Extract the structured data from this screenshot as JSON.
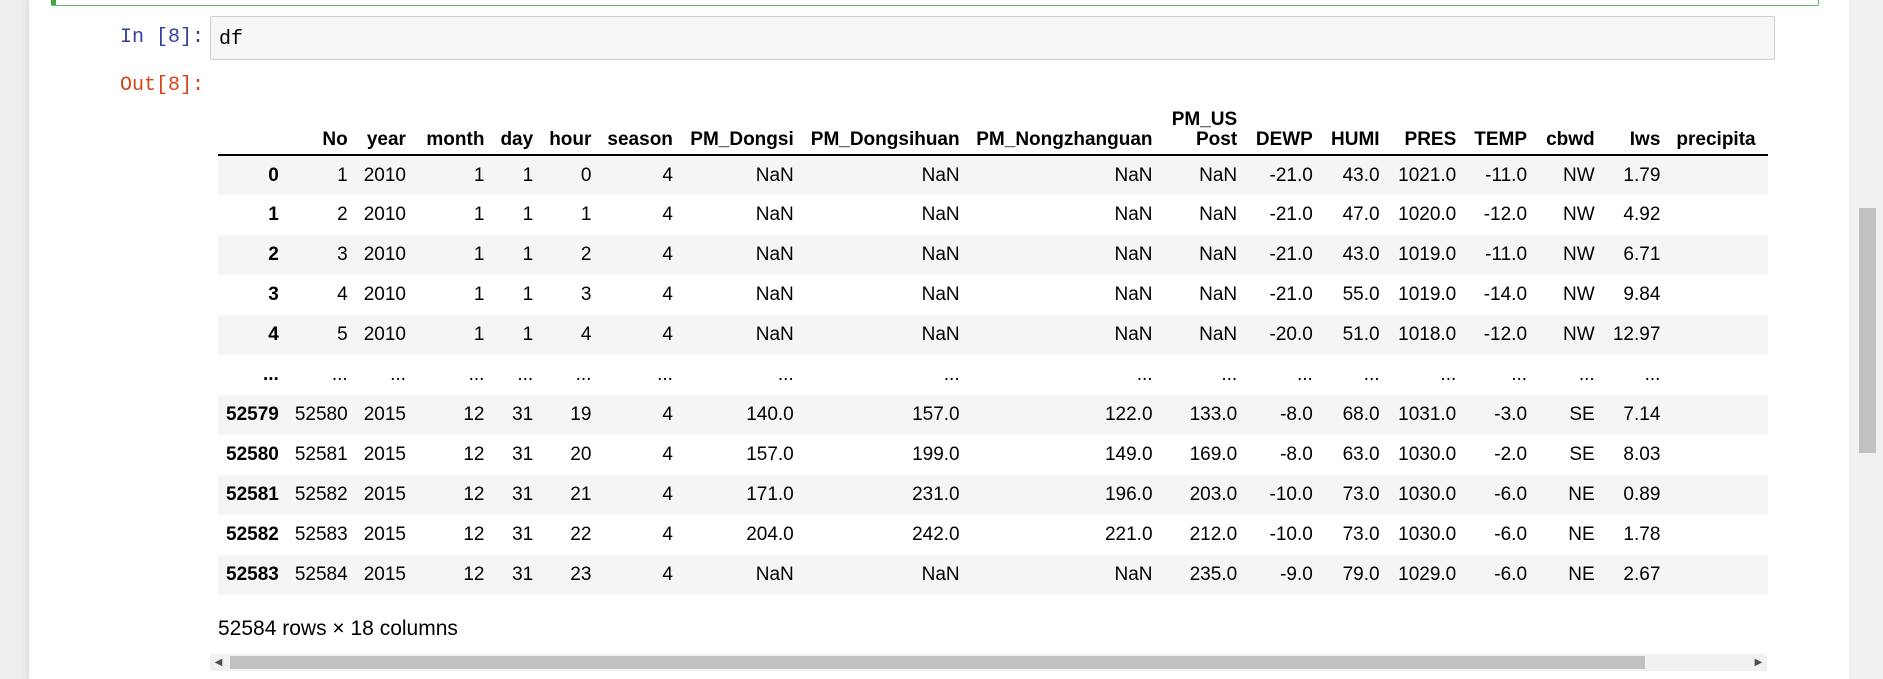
{
  "input_cell": {
    "prompt": "In  [8]:",
    "code": "df"
  },
  "output_cell": {
    "prompt": "Out[8]:",
    "columns": [
      "",
      "No",
      "year",
      "month",
      "day",
      "hour",
      "season",
      "PM_Dongsi",
      "PM_Dongsihuan",
      "PM_Nongzhanguan",
      "PM_US Post",
      "DEWP",
      "HUMI",
      "PRES",
      "TEMP",
      "cbwd",
      "Iws",
      "precipita"
    ],
    "rows": [
      [
        "0",
        "1",
        "2010",
        "1",
        "1",
        "0",
        "4",
        "NaN",
        "NaN",
        "NaN",
        "NaN",
        "-21.0",
        "43.0",
        "1021.0",
        "-11.0",
        "NW",
        "1.79",
        ""
      ],
      [
        "1",
        "2",
        "2010",
        "1",
        "1",
        "1",
        "4",
        "NaN",
        "NaN",
        "NaN",
        "NaN",
        "-21.0",
        "47.0",
        "1020.0",
        "-12.0",
        "NW",
        "4.92",
        ""
      ],
      [
        "2",
        "3",
        "2010",
        "1",
        "1",
        "2",
        "4",
        "NaN",
        "NaN",
        "NaN",
        "NaN",
        "-21.0",
        "43.0",
        "1019.0",
        "-11.0",
        "NW",
        "6.71",
        ""
      ],
      [
        "3",
        "4",
        "2010",
        "1",
        "1",
        "3",
        "4",
        "NaN",
        "NaN",
        "NaN",
        "NaN",
        "-21.0",
        "55.0",
        "1019.0",
        "-14.0",
        "NW",
        "9.84",
        ""
      ],
      [
        "4",
        "5",
        "2010",
        "1",
        "1",
        "4",
        "4",
        "NaN",
        "NaN",
        "NaN",
        "NaN",
        "-20.0",
        "51.0",
        "1018.0",
        "-12.0",
        "NW",
        "12.97",
        ""
      ],
      [
        "...",
        "...",
        "...",
        "...",
        "...",
        "...",
        "...",
        "...",
        "...",
        "...",
        "...",
        "...",
        "...",
        "...",
        "...",
        "...",
        "...",
        ""
      ],
      [
        "52579",
        "52580",
        "2015",
        "12",
        "31",
        "19",
        "4",
        "140.0",
        "157.0",
        "122.0",
        "133.0",
        "-8.0",
        "68.0",
        "1031.0",
        "-3.0",
        "SE",
        "7.14",
        ""
      ],
      [
        "52580",
        "52581",
        "2015",
        "12",
        "31",
        "20",
        "4",
        "157.0",
        "199.0",
        "149.0",
        "169.0",
        "-8.0",
        "63.0",
        "1030.0",
        "-2.0",
        "SE",
        "8.03",
        ""
      ],
      [
        "52581",
        "52582",
        "2015",
        "12",
        "31",
        "21",
        "4",
        "171.0",
        "231.0",
        "196.0",
        "203.0",
        "-10.0",
        "73.0",
        "1030.0",
        "-6.0",
        "NE",
        "0.89",
        ""
      ],
      [
        "52582",
        "52583",
        "2015",
        "12",
        "31",
        "22",
        "4",
        "204.0",
        "242.0",
        "221.0",
        "212.0",
        "-10.0",
        "73.0",
        "1030.0",
        "-6.0",
        "NE",
        "1.78",
        ""
      ],
      [
        "52583",
        "52584",
        "2015",
        "12",
        "31",
        "23",
        "4",
        "NaN",
        "NaN",
        "NaN",
        "235.0",
        "-9.0",
        "79.0",
        "1029.0",
        "-6.0",
        "NE",
        "2.67",
        ""
      ]
    ],
    "shape_text": "52584 rows × 18 columns"
  },
  "scrollbar": {
    "left_arrow": "◀",
    "right_arrow": "▶"
  },
  "colors": {
    "in_prompt": "#303f9f",
    "out_prompt": "#d84315",
    "selected_cell_border": "#42a542"
  }
}
